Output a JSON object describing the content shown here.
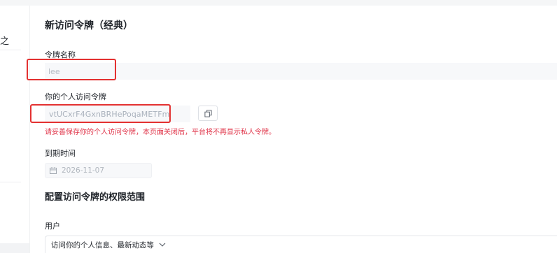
{
  "sidebar": {
    "fragment": "之"
  },
  "page_title": "新访问令牌（经典）",
  "token_name": {
    "label": "令牌名称",
    "value": "lee"
  },
  "personal_token": {
    "label": "你的个人访问令牌",
    "value": "vtUCxrF4GxnBRHePoqaMETFm",
    "warning": "请妥善保存你的个人访问令牌，本页面关闭后，平台将不再显示私人令牌。"
  },
  "expiration": {
    "label": "到期时间",
    "value": "2026-11-07"
  },
  "scope": {
    "title": "配置访问令牌的权限范围",
    "user_label": "用户",
    "user_select_value": "访问你的个人信息、最新动态等"
  },
  "colors": {
    "warning": "#e0354a",
    "highlight_box": "#e33131"
  }
}
